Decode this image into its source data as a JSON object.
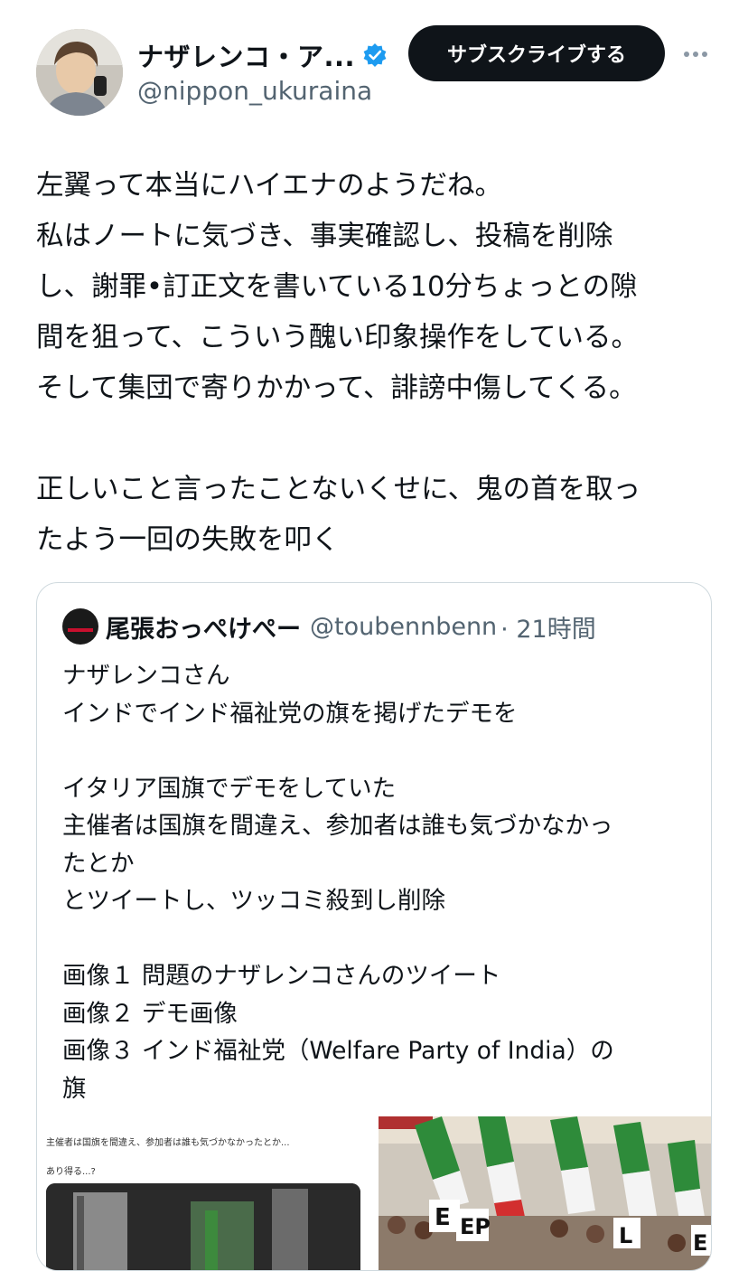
{
  "author": {
    "display_name": "ナザレンコ・ア...",
    "handle": "@nippon_ukuraina"
  },
  "actions": {
    "subscribe_label": "サブスクライブする"
  },
  "tweet": {
    "lines": [
      "左翼って本当にハイエナのようだね。",
      "私はノートに気づき、事実確認し、投稿を削除",
      "し、謝罪•訂正文を書いている10分ちょっとの隙",
      "間を狙って、こういう醜い印象操作をしている。",
      "そして集団で寄りかかって、誹謗中傷してくる。",
      "",
      "正しいこと言ったことないくせに、鬼の首を取っ",
      "たよう一回の失敗を叩く"
    ]
  },
  "quote": {
    "display_name": "尾張おっぺけぺー",
    "handle": "@toubennbenn",
    "time": "· 21時間",
    "lines": [
      "ナザレンコさん",
      "インドでインド福祉党の旗を掲げたデモを",
      "",
      "イタリア国旗でデモをしていた",
      "主催者は国旗を間違え、参加者は誰も気づかなかっ",
      "たとか",
      "とツイートし、ツッコミ殺到し削除",
      "",
      "画像１ 問題のナザレンコさんのツイート",
      "画像２ デモ画像",
      "画像３ インド福祉党（Welfare Party of India）の",
      "旗"
    ],
    "media": {
      "screenshot_text_1": "主催者は国旗を間違え、参加者は誰も気づかなかったとか...",
      "screenshot_text_2": "あり得る...?"
    }
  },
  "colors": {
    "text": "#0f1419",
    "secondary": "#536471",
    "verified": "#1d9bf0",
    "border": "#cfd9de"
  }
}
